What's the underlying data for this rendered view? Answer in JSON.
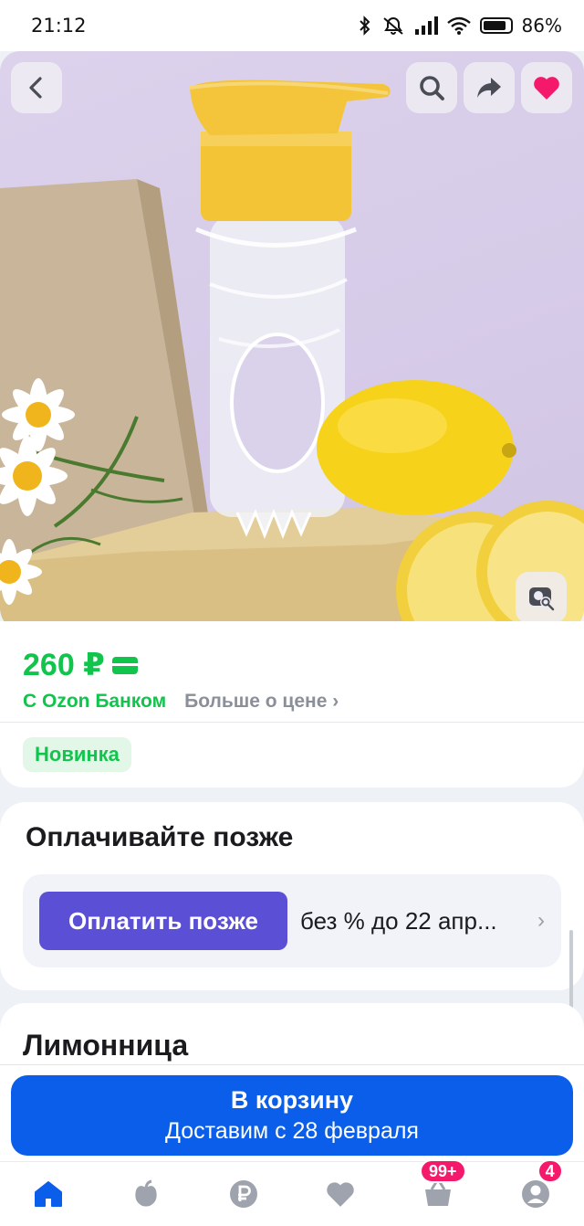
{
  "status_bar": {
    "time": "21:12",
    "battery_percent": "86%",
    "battery_level": 0.86,
    "icons": [
      "bluetooth-icon",
      "mute-icon",
      "signal-icon",
      "wifi-icon",
      "battery-icon"
    ]
  },
  "hero": {
    "buttons": [
      "back-icon",
      "search-icon",
      "share-icon",
      "favorite-heart-icon"
    ],
    "photo_search_icon": "image-search-icon"
  },
  "product": {
    "price": "260 ₽",
    "bank_label": "С Ozon Банком",
    "more_price_label": "Больше о цене",
    "badge": "Новинка"
  },
  "pay_later": {
    "title": "Оплачивайте позже",
    "button_label": "Оплатить позже",
    "terms": "без % до 22 апр..."
  },
  "product_title": "Лимонница",
  "cart": {
    "button_label": "В корзину",
    "delivery": "Доставим с 28 февраля"
  },
  "bottom_nav": {
    "items": [
      "home-icon",
      "fresh-icon",
      "ruble-icon",
      "favorites-icon",
      "cart-icon",
      "profile-icon"
    ],
    "cart_badge": "99+",
    "profile_badge": "4"
  },
  "colors": {
    "green_accent": "#10c44c",
    "pay_later_purple": "#5b4fd6",
    "primary_blue": "#0a5eea",
    "badge_pink": "#f5196c"
  }
}
